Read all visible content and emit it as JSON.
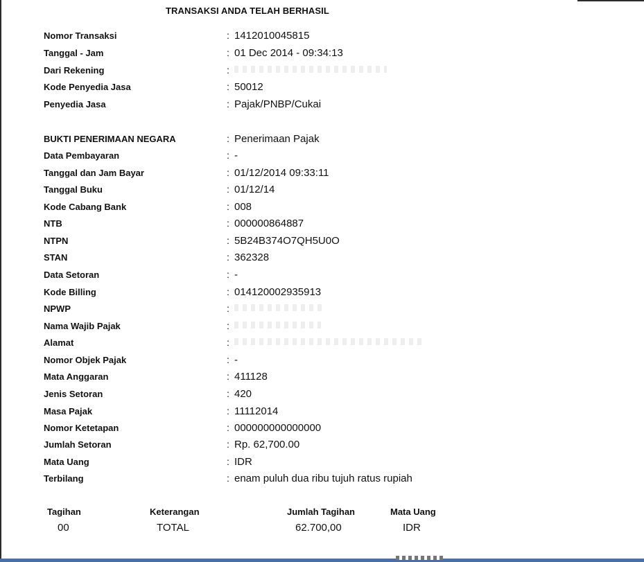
{
  "title": "TRANSAKSI ANDA TELAH BERHASIL",
  "fields": [
    {
      "label": "Nomor Transaksi",
      "value": "1412010045815"
    },
    {
      "label": "Tanggal - Jam",
      "value": "01 Dec 2014 - 09:34:13"
    },
    {
      "label": "Dari Rekening",
      "value": ""
    },
    {
      "label": "Kode Penyedia Jasa",
      "value": "50012"
    },
    {
      "label": "Penyedia Jasa",
      "value": "Pajak/PNBP/Cukai"
    },
    {
      "label": "BUKTI PENERIMAAN NEGARA",
      "value": "Penerimaan Pajak"
    },
    {
      "label": "Data Pembayaran",
      "value": "-"
    },
    {
      "label": "Tanggal dan Jam Bayar",
      "value": "01/12/2014 09:33:11"
    },
    {
      "label": "Tanggal Buku",
      "value": "01/12/14"
    },
    {
      "label": "Kode Cabang Bank",
      "value": "008"
    },
    {
      "label": "NTB",
      "value": "000000864887"
    },
    {
      "label": "NTPN",
      "value": "5B24B374O7QH5U0O"
    },
    {
      "label": "STAN",
      "value": "362328"
    },
    {
      "label": "Data Setoran",
      "value": "-"
    },
    {
      "label": "Kode Billing",
      "value": "014120002935913"
    },
    {
      "label": "NPWP",
      "value": ""
    },
    {
      "label": "Nama Wajib Pajak",
      "value": ""
    },
    {
      "label": "Alamat",
      "value": ""
    },
    {
      "label": "Nomor Objek Pajak",
      "value": "-"
    },
    {
      "label": "Mata Anggaran",
      "value": "411128"
    },
    {
      "label": "Jenis Setoran",
      "value": "420"
    },
    {
      "label": "Masa Pajak",
      "value": "11112014"
    },
    {
      "label": "Nomor Ketetapan",
      "value": "000000000000000"
    },
    {
      "label": "Jumlah Setoran",
      "value": "Rp. 62,700.00"
    },
    {
      "label": "Mata Uang",
      "value": "IDR"
    },
    {
      "label": "Terbilang",
      "value": "enam puluh dua ribu tujuh ratus rupiah"
    }
  ],
  "separator": ":",
  "bill": {
    "headers": {
      "tagihan": "Tagihan",
      "keterangan": "Keterangan",
      "jumlah": "Jumlah Tagihan",
      "mata_uang": "Mata Uang"
    },
    "row": {
      "tagihan": "00",
      "keterangan": "TOTAL",
      "jumlah": "62.700,00",
      "mata_uang": "IDR"
    }
  }
}
